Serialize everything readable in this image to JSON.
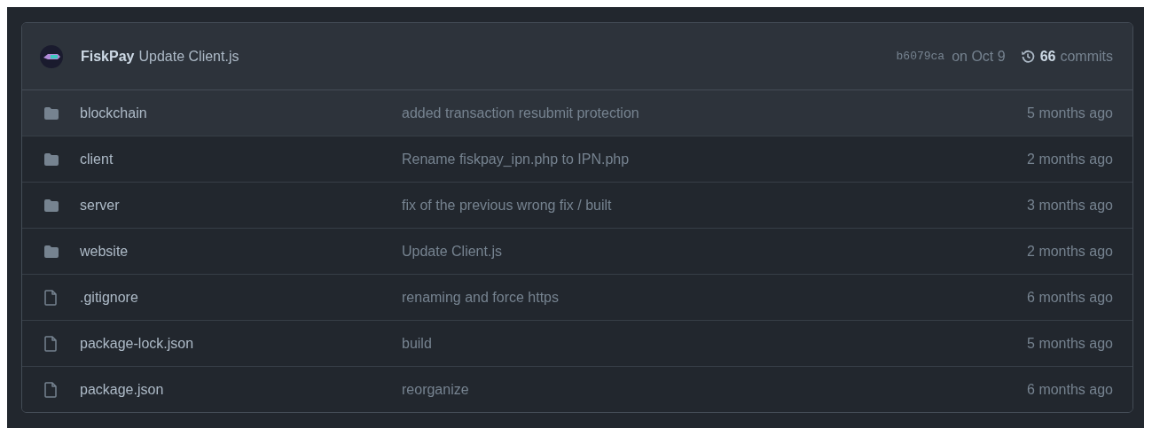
{
  "latest_commit": {
    "author": "FiskPay",
    "message": "Update Client.js",
    "hash": "b6079ca",
    "date": "on Oct 9",
    "commit_count": "66",
    "commit_label": "commits"
  },
  "files": [
    {
      "kind": "folder",
      "name": "blockchain",
      "message": "added transaction resubmit protection",
      "age": "5 months ago",
      "selected": true
    },
    {
      "kind": "folder",
      "name": "client",
      "message": "Rename fiskpay_ipn.php to IPN.php",
      "age": "2 months ago",
      "selected": false
    },
    {
      "kind": "folder",
      "name": "server",
      "message": "fix of the previous wrong fix / built",
      "age": "3 months ago",
      "selected": false
    },
    {
      "kind": "folder",
      "name": "website",
      "message": "Update Client.js",
      "age": "2 months ago",
      "selected": false
    },
    {
      "kind": "file",
      "name": ".gitignore",
      "message": "renaming and force https",
      "age": "6 months ago",
      "selected": false
    },
    {
      "kind": "file",
      "name": "package-lock.json",
      "message": "build",
      "age": "5 months ago",
      "selected": false
    },
    {
      "kind": "file",
      "name": "package.json",
      "message": "reorganize",
      "age": "6 months ago",
      "selected": false
    }
  ]
}
